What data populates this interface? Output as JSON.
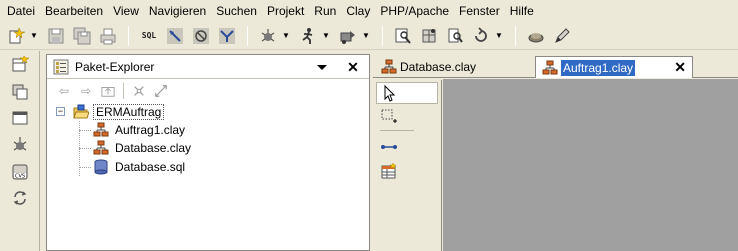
{
  "menubar": {
    "items": [
      "Datei",
      "Bearbeiten",
      "View",
      "Navigieren",
      "Suchen",
      "Projekt",
      "Run",
      "Clay",
      "PHP/Apache",
      "Fenster",
      "Hilfe"
    ]
  },
  "toolbar": {
    "sql_label": "SQL",
    "icons": [
      "new-wizard-icon",
      "save-icon",
      "save-all-icon",
      "print-icon",
      "sql-icon",
      "sql-run-icon",
      "sql-stop-icon",
      "sql-explain-icon",
      "debug-icon",
      "run-icon",
      "external-tools-icon",
      "open-type-icon",
      "open-resource-icon",
      "search-icon",
      "refresh-icon",
      "clay-icon",
      "edit-icon"
    ]
  },
  "explorer": {
    "title": "Paket-Explorer",
    "tree": {
      "project": "ERMAuftrag",
      "children": [
        "Auftrag1.clay",
        "Database.clay",
        "Database.sql"
      ]
    }
  },
  "editor": {
    "tabs": [
      {
        "label": "Database.clay",
        "active": false
      },
      {
        "label": "Auftrag1.clay",
        "active": true
      }
    ],
    "close_glyph": "✕"
  },
  "explorer_close_glyph": "✕",
  "colors": {
    "accent": "#316ac5",
    "canvas": "#a0a0a0",
    "chrome": "#ece9d8"
  }
}
